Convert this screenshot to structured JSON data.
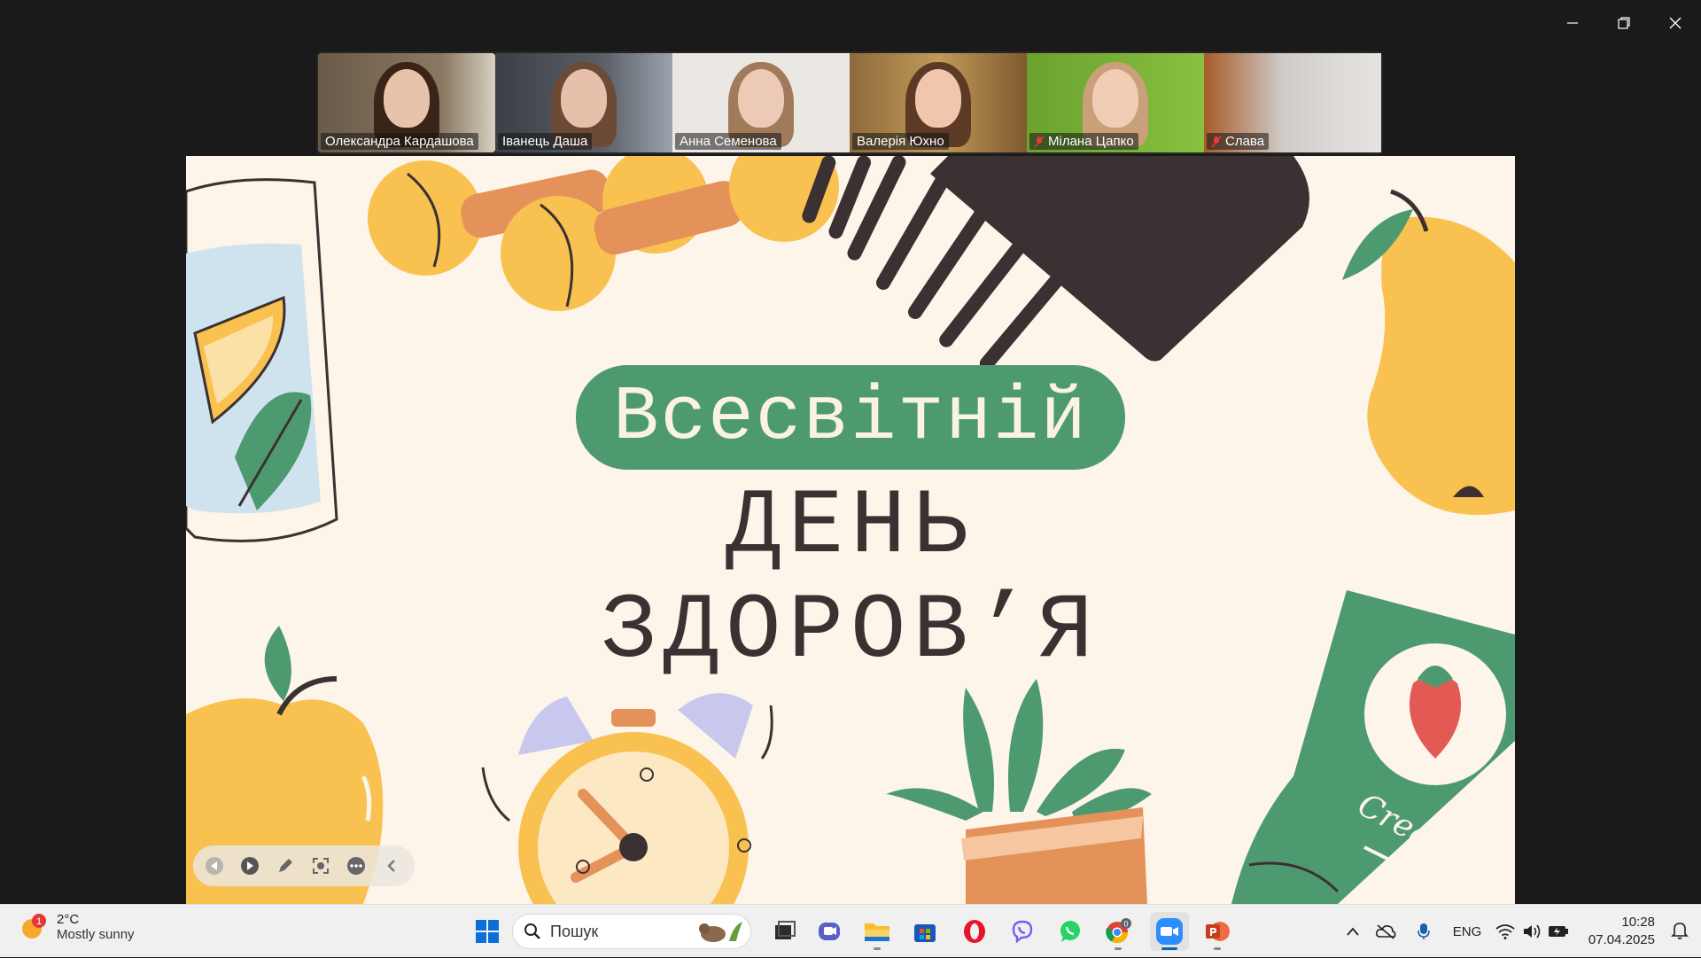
{
  "window": {
    "controls": [
      "minimize",
      "restore",
      "close"
    ]
  },
  "participants": [
    {
      "name": "Олександра Кардашова",
      "muted": false,
      "active": true,
      "bg": "#7c6a55",
      "hair": "#3a2418"
    },
    {
      "name": "Іванець Даша",
      "muted": false,
      "active": false,
      "bg": "#4b4f58",
      "hair": "#6b4b36"
    },
    {
      "name": "Анна Семенова",
      "muted": false,
      "active": false,
      "bg": "#e9e7e3",
      "hair": "#a07a5a"
    },
    {
      "name": "Валерія Юхно",
      "muted": false,
      "active": false,
      "bg": "#b8904e",
      "hair": "#5c3a26"
    },
    {
      "name": "Мілана Цапко",
      "muted": true,
      "active": false,
      "bg": "#7fb23a",
      "hair": "#c9a07a"
    },
    {
      "name": "Слава",
      "muted": true,
      "active": false,
      "bg": "#c9c7c4",
      "hair": "#8a5a3a"
    }
  ],
  "slide": {
    "title_line1": "Всесвітній",
    "title_line2": "ДЕНЬ ЗДОРОВ’Я",
    "cream_label": "Cream",
    "colors": {
      "background": "#fdf5ea",
      "green": "#4e9a70",
      "yellow": "#f9c14f",
      "dark": "#3b3133",
      "lavender": "#c8c8ef",
      "orange": "#e4925a"
    }
  },
  "presentation_toolbar": {
    "buttons": [
      "previous-icon",
      "next-icon",
      "pen-icon",
      "focus-icon",
      "more-icon",
      "collapse-icon"
    ]
  },
  "taskbar": {
    "weather": {
      "badge": "1",
      "temp": "2°C",
      "desc": "Mostly sunny"
    },
    "search_placeholder": "Пошук",
    "apps": [
      "start",
      "search",
      "task-view",
      "teams",
      "file-explorer",
      "store",
      "opera",
      "viber",
      "whatsapp",
      "chrome",
      "zoom",
      "powerpoint"
    ],
    "chrome_badge": "0",
    "tray": {
      "language": "ENG"
    },
    "clock": {
      "time": "10:28",
      "date": "07.04.2025"
    }
  }
}
